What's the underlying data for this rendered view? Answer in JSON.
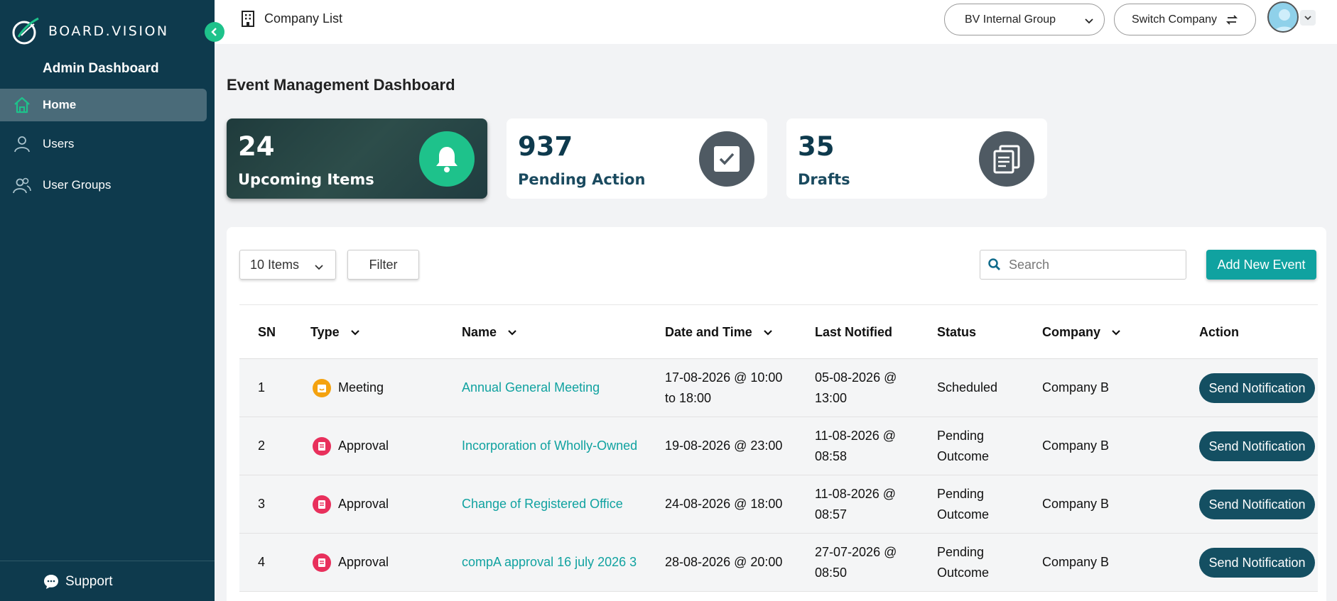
{
  "sidebar": {
    "brand": "BOARD.VISION",
    "title": "Admin Dashboard",
    "items": [
      {
        "label": "Home",
        "icon": "home-icon",
        "active": true
      },
      {
        "label": "Users",
        "icon": "user-icon",
        "active": false
      },
      {
        "label": "User Groups",
        "icon": "users-icon",
        "active": false
      }
    ],
    "support_label": "Support"
  },
  "topbar": {
    "company_list_label": "Company List",
    "group_selected": "BV Internal Group",
    "switch_label": "Switch Company"
  },
  "page": {
    "title": "Event Management Dashboard"
  },
  "stats": [
    {
      "value": "24",
      "label": "Upcoming Items",
      "icon": "bell-icon",
      "icon_color": "#1ec28b"
    },
    {
      "value": "937",
      "label": "Pending Action",
      "icon": "check-square-icon",
      "icon_color": "#4f5a63"
    },
    {
      "value": "35",
      "label": "Drafts",
      "icon": "documents-icon",
      "icon_color": "#4f5a63"
    }
  ],
  "toolbar": {
    "items_per_page": "10 Items",
    "filter_label": "Filter",
    "search_placeholder": "Search",
    "add_label": "Add New Event"
  },
  "table": {
    "headers": {
      "sn": "SN",
      "type": "Type",
      "name": "Name",
      "datetime": "Date and Time",
      "last_notified": "Last Notified",
      "status": "Status",
      "company": "Company",
      "action": "Action"
    },
    "rows": [
      {
        "sn": "1",
        "type": "Meeting",
        "type_color": "#f4a20f",
        "name": "Annual General Meeting",
        "datetime_1": "17-08-2026 @ 10:00",
        "datetime_2": "to 18:00",
        "notified_1": "05-08-2026 @",
        "notified_2": "13:00",
        "status_1": "Scheduled",
        "status_2": "",
        "company": "Company B",
        "action": "Send Notification"
      },
      {
        "sn": "2",
        "type": "Approval",
        "type_color": "#e8305c",
        "name": "Incorporation of Wholly-Owned",
        "datetime_1": "19-08-2026 @ 23:00",
        "datetime_2": "",
        "notified_1": "11-08-2026 @",
        "notified_2": "08:58",
        "status_1": "Pending",
        "status_2": "Outcome",
        "company": "Company B",
        "action": "Send Notification"
      },
      {
        "sn": "3",
        "type": "Approval",
        "type_color": "#e8305c",
        "name": "Change of Registered Office",
        "datetime_1": "24-08-2026 @ 18:00",
        "datetime_2": "",
        "notified_1": "11-08-2026 @",
        "notified_2": "08:57",
        "status_1": "Pending",
        "status_2": "Outcome",
        "company": "Company B",
        "action": "Send Notification"
      },
      {
        "sn": "4",
        "type": "Approval",
        "type_color": "#e8305c",
        "name": "compA approval 16 july 2026 3",
        "datetime_1": "28-08-2026 @ 20:00",
        "datetime_2": "",
        "notified_1": "27-07-2026 @",
        "notified_2": "08:50",
        "status_1": "Pending",
        "status_2": "Outcome",
        "company": "Company B",
        "action": "Send Notification"
      }
    ]
  },
  "colors": {
    "sidebar_bg": "#0e3a4d",
    "accent": "#10a2a0",
    "action_button": "#144f62"
  }
}
